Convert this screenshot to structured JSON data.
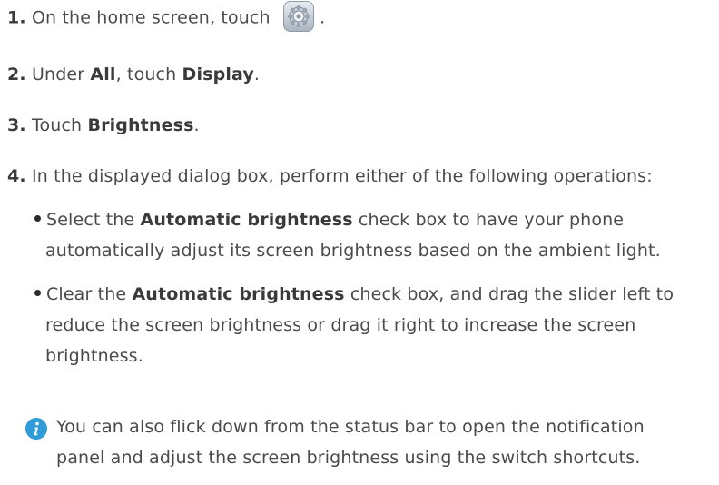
{
  "steps": [
    {
      "num": "1.",
      "pre": "On the home screen, touch",
      "post": "."
    },
    {
      "num": "2.",
      "pre": "Under ",
      "b1": "All",
      "mid": ", touch ",
      "b2": "Display",
      "post": "."
    },
    {
      "num": "3.",
      "pre": "Touch ",
      "b1": "Brightness",
      "post": "."
    },
    {
      "num": "4.",
      "text": "In the displayed dialog box, perform either of the following operations:"
    }
  ],
  "bullets": [
    {
      "pre": "Select the ",
      "bold": "Automatic brightness",
      "line1_rest": " check box to have your phone",
      "line2": "automatically adjust its screen brightness based on the ambient light."
    },
    {
      "pre": "Clear the ",
      "bold": "Automatic brightness",
      "line1_rest": " check box, and drag the slider left to",
      "line2": "reduce the screen brightness or drag it right to increase the screen",
      "line3": "brightness."
    }
  ],
  "note": {
    "icon": "info-icon",
    "line1": "You can also flick down from the status bar to open the notification",
    "line2": "panel and adjust the screen brightness using the switch shortcuts."
  },
  "icons": {
    "settings": "settings-gear-icon"
  }
}
